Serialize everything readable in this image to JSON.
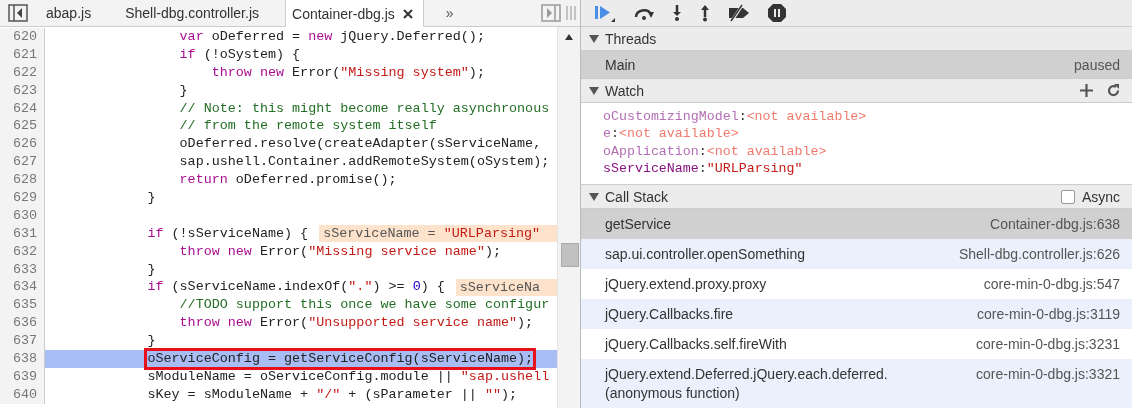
{
  "tabs": [
    {
      "label": "abap.js",
      "selected": false
    },
    {
      "label": "Shell-dbg.controller.js",
      "selected": false
    },
    {
      "label": "Container-dbg.js",
      "selected": true
    }
  ],
  "overflow": "»",
  "code": [
    {
      "number": "620",
      "current": false,
      "boxed": false,
      "tokens": [
        {
          "kind": "keyword",
          "text": "                var"
        },
        {
          "kind": "plain",
          "text": " oDeferred = "
        },
        {
          "kind": "keyword",
          "text": "new"
        },
        {
          "kind": "plain",
          "text": " jQuery.Deferred();"
        }
      ]
    },
    {
      "number": "621",
      "current": false,
      "boxed": false,
      "tokens": [
        {
          "kind": "keyword",
          "text": "                if"
        },
        {
          "kind": "plain",
          "text": " (!oSystem) {"
        }
      ]
    },
    {
      "number": "622",
      "current": false,
      "boxed": false,
      "tokens": [
        {
          "kind": "keyword",
          "text": "                    throw new"
        },
        {
          "kind": "plain",
          "text": " Error("
        },
        {
          "kind": "string",
          "text": "\"Missing system\""
        },
        {
          "kind": "plain",
          "text": ");"
        }
      ]
    },
    {
      "number": "623",
      "current": false,
      "boxed": false,
      "tokens": [
        {
          "kind": "plain",
          "text": "                }"
        }
      ]
    },
    {
      "number": "624",
      "current": false,
      "boxed": false,
      "tokens": [
        {
          "kind": "comment",
          "text": "                // Note: this might become really asynchronous"
        }
      ]
    },
    {
      "number": "625",
      "current": false,
      "boxed": false,
      "tokens": [
        {
          "kind": "comment",
          "text": "                // from the remote system itself"
        }
      ]
    },
    {
      "number": "626",
      "current": false,
      "boxed": false,
      "tokens": [
        {
          "kind": "plain",
          "text": "                oDeferred.resolve(createAdapter(sServiceName,"
        }
      ]
    },
    {
      "number": "627",
      "current": false,
      "boxed": false,
      "tokens": [
        {
          "kind": "plain",
          "text": "                sap.ushell.Container.addRemoteSystem(oSystem);"
        }
      ]
    },
    {
      "number": "628",
      "current": false,
      "boxed": false,
      "tokens": [
        {
          "kind": "keyword",
          "text": "                return"
        },
        {
          "kind": "plain",
          "text": " oDeferred.promise();"
        }
      ]
    },
    {
      "number": "629",
      "current": false,
      "boxed": false,
      "tokens": [
        {
          "kind": "plain",
          "text": "            }"
        }
      ]
    },
    {
      "number": "630",
      "current": false,
      "boxed": false
    },
    {
      "number": "631",
      "current": false,
      "boxed": false,
      "tokens": [
        {
          "kind": "keyword",
          "text": "            if"
        },
        {
          "kind": "plain",
          "text": " (!sServiceName) {"
        }
      ],
      "hint": [
        {
          "kind": "plain",
          "text": "sServiceName = "
        },
        {
          "kind": "string",
          "text": "\"URLParsing\""
        }
      ]
    },
    {
      "number": "632",
      "current": false,
      "boxed": false,
      "tokens": [
        {
          "kind": "keyword",
          "text": "                throw new"
        },
        {
          "kind": "plain",
          "text": " Error("
        },
        {
          "kind": "string",
          "text": "\"Missing service name\""
        },
        {
          "kind": "plain",
          "text": ");"
        }
      ]
    },
    {
      "number": "633",
      "current": false,
      "boxed": false,
      "tokens": [
        {
          "kind": "plain",
          "text": "            }"
        }
      ]
    },
    {
      "number": "634",
      "current": false,
      "boxed": false,
      "tokens": [
        {
          "kind": "keyword",
          "text": "            if"
        },
        {
          "kind": "plain",
          "text": " (sServiceName.indexOf("
        },
        {
          "kind": "string",
          "text": "\".\""
        },
        {
          "kind": "plain",
          "text": ") >= "
        },
        {
          "kind": "number",
          "text": "0"
        },
        {
          "kind": "plain",
          "text": ") {"
        }
      ],
      "hint": [
        {
          "kind": "plain",
          "text": "sServiceNa"
        }
      ]
    },
    {
      "number": "635",
      "current": false,
      "boxed": false,
      "tokens": [
        {
          "kind": "comment",
          "text": "                //TODO support this once we have some configur"
        }
      ]
    },
    {
      "number": "636",
      "current": false,
      "boxed": false,
      "tokens": [
        {
          "kind": "keyword",
          "text": "                throw new"
        },
        {
          "kind": "plain",
          "text": " Error("
        },
        {
          "kind": "string",
          "text": "\"Unsupported service name\""
        },
        {
          "kind": "plain",
          "text": ");"
        }
      ]
    },
    {
      "number": "637",
      "current": false,
      "boxed": false,
      "tokens": [
        {
          "kind": "plain",
          "text": "            }"
        }
      ]
    },
    {
      "number": "638",
      "current": true,
      "boxed": true,
      "tokens": [
        {
          "kind": "plain",
          "text": "            oServiceConfig = getServiceConfig(sServiceName);"
        }
      ]
    },
    {
      "number": "639",
      "current": false,
      "boxed": false,
      "tokens": [
        {
          "kind": "plain",
          "text": "            sModuleName = oServiceConfig.module || "
        },
        {
          "kind": "string",
          "text": "\"sap.ushell"
        }
      ]
    },
    {
      "number": "640",
      "current": false,
      "boxed": false,
      "tokens": [
        {
          "kind": "plain",
          "text": "            sKey = sModuleName + "
        },
        {
          "kind": "string",
          "text": "\"/\""
        },
        {
          "kind": "plain",
          "text": " + (sParameter || "
        },
        {
          "kind": "string",
          "text": "\"\""
        },
        {
          "kind": "plain",
          "text": ");"
        }
      ]
    }
  ],
  "threads": {
    "title": "Threads",
    "expanded": true,
    "rows": [
      {
        "name": "Main",
        "status": "paused",
        "selected": true
      }
    ]
  },
  "watch": {
    "title": "Watch",
    "expanded": true,
    "entries": [
      {
        "name": "oCustomizingModel",
        "separator": ":",
        "value": "<not available>",
        "kind": "unavailable"
      },
      {
        "name": "e",
        "separator": ":",
        "value": "<not available>",
        "kind": "unavailable"
      },
      {
        "name": "oApplication",
        "separator": ":",
        "value": "<not available>",
        "kind": "unavailable"
      },
      {
        "name": "sServiceName",
        "separator": ":",
        "value": "\"URLParsing\"",
        "kind": "string"
      }
    ]
  },
  "call_stack": {
    "title": "Call Stack",
    "expanded": true,
    "async": {
      "label": "Async",
      "checked": false
    },
    "frames": [
      {
        "function": "getService",
        "location": "Container-dbg.js:638",
        "selected": true
      },
      {
        "function": "sap.ui.controller.openSomething",
        "location": "Shell-dbg.controller.js:626",
        "selected": false
      },
      {
        "function": "jQuery.extend.proxy.proxy",
        "location": "core-min-0-dbg.js:547",
        "selected": false
      },
      {
        "function": "jQuery.Callbacks.fire",
        "location": "core-min-0-dbg.js:3119",
        "selected": false
      },
      {
        "function": "jQuery.Callbacks.self.fireWith",
        "location": "core-min-0-dbg.js:3231",
        "selected": false
      },
      {
        "function": "jQuery.extend.Deferred.jQuery.each.deferred.\n(anonymous function)",
        "location": "core-min-0-dbg.js:3321",
        "selected": false
      }
    ]
  }
}
